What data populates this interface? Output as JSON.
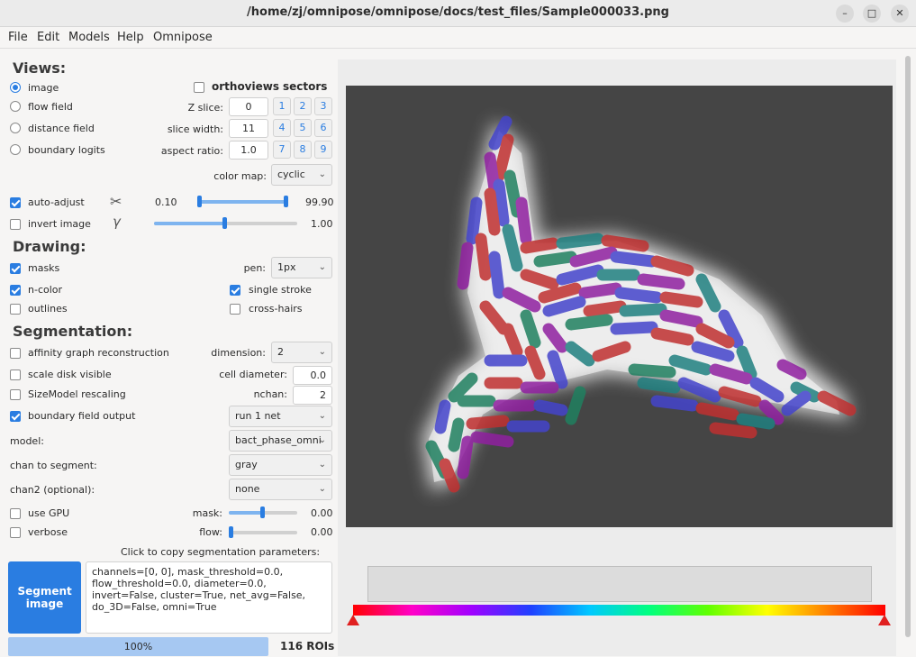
{
  "window": {
    "title": "/home/zj/omnipose/omnipose/docs/test_files/Sample000033.png",
    "controls": [
      "–",
      "□",
      "✕"
    ]
  },
  "menu": [
    "File",
    "Edit",
    "Models",
    "Help",
    "Omnipose"
  ],
  "views": {
    "header": "Views:",
    "radios": [
      {
        "label": "image",
        "selected": true
      },
      {
        "label": "flow field",
        "selected": false
      },
      {
        "label": "distance field",
        "selected": false
      },
      {
        "label": "boundary logits",
        "selected": false
      }
    ],
    "orthoviews_label": "orthoviews",
    "sectors_label": "sectors",
    "z_slice_label": "Z slice:",
    "z_slice_value": "0",
    "slice_width_label": "slice width:",
    "slice_width_value": "11",
    "aspect_ratio_label": "aspect ratio:",
    "aspect_ratio_value": "1.0",
    "sector_buttons": [
      "1",
      "2",
      "3",
      "4",
      "5",
      "6",
      "7",
      "8",
      "9"
    ],
    "color_map_label": "color map:",
    "color_map_value": "cyclic",
    "auto_adjust_label": "auto-adjust",
    "auto_adjust_min": "0.10",
    "auto_adjust_max": "99.90",
    "invert_label": "invert image",
    "gamma_value": "1.00"
  },
  "drawing": {
    "header": "Drawing:",
    "masks_label": "masks",
    "ncolor_label": "n-color",
    "outlines_label": "outlines",
    "pen_label": "pen:",
    "pen_value": "1px",
    "single_stroke_label": "single stroke",
    "crosshairs_label": "cross-hairs"
  },
  "segmentation": {
    "header": "Segmentation:",
    "affinity_label": "affinity graph reconstruction",
    "dimension_label": "dimension:",
    "dimension_value": "2",
    "scale_disk_label": "scale disk visible",
    "cell_diameter_label": "cell diameter:",
    "cell_diameter_value": "0.0",
    "sizemodel_label": "SizeModel rescaling",
    "nchan_label": "nchan:",
    "nchan_value": "2",
    "boundary_label": "boundary field output",
    "run_value": "run 1 net",
    "model_label": "model:",
    "model_value": "bact_phase_omni",
    "chan_label": "chan to segment:",
    "chan_value": "gray",
    "chan2_label": "chan2 (optional):",
    "chan2_value": "none",
    "gpu_label": "use GPU",
    "mask_label": "mask:",
    "mask_value": "0.00",
    "verbose_label": "verbose",
    "flow_label": "flow:",
    "flow_value": "0.00",
    "copy_hint": "Click to copy segmentation parameters:",
    "segment_button": "Segment image",
    "params_text": "channels=[0, 0], mask_threshold=0.0, flow_threshold=0.0, diameter=0.0, invert=False, cluster=True, net_avg=False, do_3D=False, omni=True",
    "progress": "100%",
    "rois": "116 ROIs"
  }
}
